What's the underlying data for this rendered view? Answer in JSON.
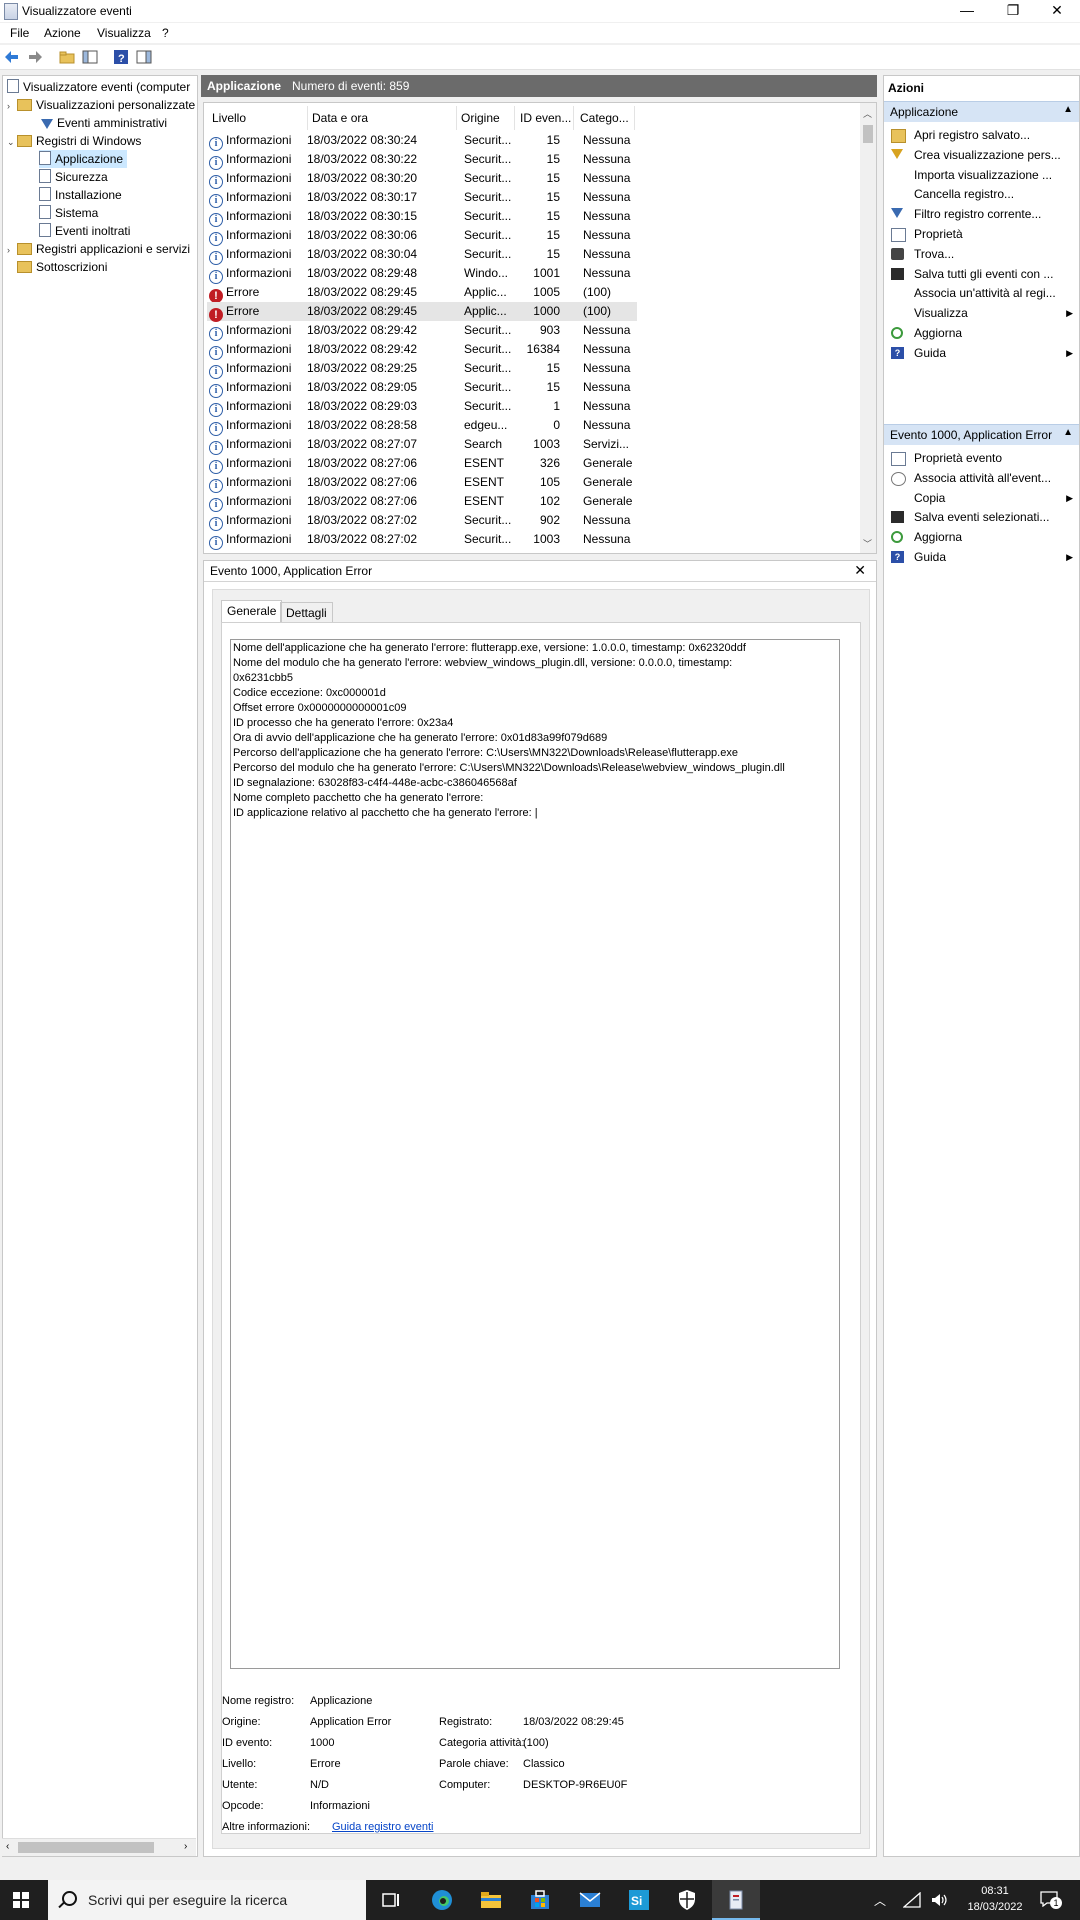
{
  "window": {
    "title": "Visualizzatore eventi",
    "controls": {
      "minimize": "—",
      "restore": "❐",
      "close": "✕"
    }
  },
  "menu": [
    "File",
    "Azione",
    "Visualizza",
    "?"
  ],
  "tree": {
    "root": "Visualizzatore eventi (computer",
    "custom_views": "Visualizzazioni personalizzate",
    "admin_events": "Eventi amministrativi",
    "windows_logs": "Registri di Windows",
    "logs": [
      "Applicazione",
      "Sicurezza",
      "Installazione",
      "Sistema",
      "Eventi inoltrati"
    ],
    "app_services": "Registri applicazioni e servizi",
    "subscriptions": "Sottoscrizioni"
  },
  "list_header": {
    "name": "Applicazione",
    "count_text": "Numero di eventi: 859"
  },
  "columns": [
    "Livello",
    "Data e ora",
    "Origine",
    "ID even...",
    "Catego..."
  ],
  "events": [
    {
      "level": "Informazioni",
      "date": "18/03/2022 08:30:24",
      "source": "Securit...",
      "id": "15",
      "category": "Nessuna",
      "type": "info"
    },
    {
      "level": "Informazioni",
      "date": "18/03/2022 08:30:22",
      "source": "Securit...",
      "id": "15",
      "category": "Nessuna",
      "type": "info"
    },
    {
      "level": "Informazioni",
      "date": "18/03/2022 08:30:20",
      "source": "Securit...",
      "id": "15",
      "category": "Nessuna",
      "type": "info"
    },
    {
      "level": "Informazioni",
      "date": "18/03/2022 08:30:17",
      "source": "Securit...",
      "id": "15",
      "category": "Nessuna",
      "type": "info"
    },
    {
      "level": "Informazioni",
      "date": "18/03/2022 08:30:15",
      "source": "Securit...",
      "id": "15",
      "category": "Nessuna",
      "type": "info"
    },
    {
      "level": "Informazioni",
      "date": "18/03/2022 08:30:06",
      "source": "Securit...",
      "id": "15",
      "category": "Nessuna",
      "type": "info"
    },
    {
      "level": "Informazioni",
      "date": "18/03/2022 08:30:04",
      "source": "Securit...",
      "id": "15",
      "category": "Nessuna",
      "type": "info"
    },
    {
      "level": "Informazioni",
      "date": "18/03/2022 08:29:48",
      "source": "Windo...",
      "id": "1001",
      "category": "Nessuna",
      "type": "info"
    },
    {
      "level": "Errore",
      "date": "18/03/2022 08:29:45",
      "source": "Applic...",
      "id": "1005",
      "category": "(100)",
      "type": "error"
    },
    {
      "level": "Errore",
      "date": "18/03/2022 08:29:45",
      "source": "Applic...",
      "id": "1000",
      "category": "(100)",
      "type": "error"
    },
    {
      "level": "Informazioni",
      "date": "18/03/2022 08:29:42",
      "source": "Securit...",
      "id": "903",
      "category": "Nessuna",
      "type": "info"
    },
    {
      "level": "Informazioni",
      "date": "18/03/2022 08:29:42",
      "source": "Securit...",
      "id": "16384",
      "category": "Nessuna",
      "type": "info"
    },
    {
      "level": "Informazioni",
      "date": "18/03/2022 08:29:25",
      "source": "Securit...",
      "id": "15",
      "category": "Nessuna",
      "type": "info"
    },
    {
      "level": "Informazioni",
      "date": "18/03/2022 08:29:05",
      "source": "Securit...",
      "id": "15",
      "category": "Nessuna",
      "type": "info"
    },
    {
      "level": "Informazioni",
      "date": "18/03/2022 08:29:03",
      "source": "Securit...",
      "id": "1",
      "category": "Nessuna",
      "type": "info"
    },
    {
      "level": "Informazioni",
      "date": "18/03/2022 08:28:58",
      "source": "edgeu...",
      "id": "0",
      "category": "Nessuna",
      "type": "info"
    },
    {
      "level": "Informazioni",
      "date": "18/03/2022 08:27:07",
      "source": "Search",
      "id": "1003",
      "category": "Servizi...",
      "type": "info"
    },
    {
      "level": "Informazioni",
      "date": "18/03/2022 08:27:06",
      "source": "ESENT",
      "id": "326",
      "category": "Generale",
      "type": "info"
    },
    {
      "level": "Informazioni",
      "date": "18/03/2022 08:27:06",
      "source": "ESENT",
      "id": "105",
      "category": "Generale",
      "type": "info"
    },
    {
      "level": "Informazioni",
      "date": "18/03/2022 08:27:06",
      "source": "ESENT",
      "id": "102",
      "category": "Generale",
      "type": "info"
    },
    {
      "level": "Informazioni",
      "date": "18/03/2022 08:27:02",
      "source": "Securit...",
      "id": "902",
      "category": "Nessuna",
      "type": "info"
    },
    {
      "level": "Informazioni",
      "date": "18/03/2022 08:27:02",
      "source": "Securit...",
      "id": "1003",
      "category": "Nessuna",
      "type": "info"
    }
  ],
  "detail": {
    "title": "Evento 1000, Application Error",
    "tabs": [
      "Generale",
      "Dettagli"
    ],
    "description": [
      "Nome dell'applicazione che ha generato l'errore: flutterapp.exe, versione: 1.0.0.0, timestamp: 0x62320ddf",
      "Nome del modulo che ha generato l'errore: webview_windows_plugin.dll, versione: 0.0.0.0, timestamp:",
      "0x6231cbb5",
      "Codice eccezione: 0xc000001d",
      "Offset errore 0x0000000000001c09",
      "ID processo che ha generato l'errore: 0x23a4",
      "Ora di avvio dell'applicazione che ha generato l'errore: 0x01d83a99f079d689",
      "Percorso dell'applicazione che ha generato l'errore: C:\\Users\\MN322\\Downloads\\Release\\flutterapp.exe",
      "Percorso del modulo che ha generato l'errore: C:\\Users\\MN322\\Downloads\\Release\\webview_windows_plugin.dll",
      "ID segnalazione: 63028f83-c4f4-448e-acbc-c386046568af",
      "Nome completo pacchetto che ha generato l'errore:",
      "ID applicazione relativo al pacchetto che ha generato l'errore: |"
    ],
    "props": {
      "log_name_label": "Nome registro:",
      "log_name": "Applicazione",
      "source_label": "Origine:",
      "source": "Application Error",
      "logged_label": "Registrato:",
      "logged": "18/03/2022 08:29:45",
      "event_id_label": "ID evento:",
      "event_id": "1000",
      "task_label": "Categoria attività:",
      "task": "(100)",
      "level_label": "Livello:",
      "level": "Errore",
      "keywords_label": "Parole chiave:",
      "keywords": "Classico",
      "user_label": "Utente:",
      "user": "N/D",
      "computer_label": "Computer:",
      "computer": "DESKTOP-9R6EU0F",
      "opcode_label": "Opcode:",
      "opcode": "Informazioni",
      "more_info_label": "Altre informazioni:",
      "more_info_link": "Guida registro eventi"
    }
  },
  "actions": {
    "title": "Azioni",
    "section1": "Applicazione",
    "items1": [
      {
        "label": "Apri registro salvato...",
        "icon": "folder-icon"
      },
      {
        "label": "Crea visualizzazione pers...",
        "icon": "filter-icon"
      },
      {
        "label": "Importa visualizzazione ...",
        "icon": ""
      },
      {
        "label": "Cancella registro...",
        "icon": ""
      },
      {
        "label": "Filtro registro corrente...",
        "icon": "filter-blue-icon"
      },
      {
        "label": "Proprietà",
        "icon": "properties-icon"
      },
      {
        "label": "Trova...",
        "icon": "binoculars-icon"
      },
      {
        "label": "Salva tutti gli eventi con ...",
        "icon": "save-icon"
      },
      {
        "label": "Associa un'attività al regi...",
        "icon": ""
      },
      {
        "label": "Visualizza",
        "icon": "",
        "sub": true
      },
      {
        "label": "Aggiorna",
        "icon": "refresh-icon"
      },
      {
        "label": "Guida",
        "icon": "help-icon",
        "sub": true
      }
    ],
    "section2": "Evento 1000, Application Error",
    "items2": [
      {
        "label": "Proprietà evento",
        "icon": "properties-icon"
      },
      {
        "label": "Associa attività all'event...",
        "icon": "task-icon"
      },
      {
        "label": "Copia",
        "icon": "copy-icon",
        "sub": true
      },
      {
        "label": "Salva eventi selezionati...",
        "icon": "save-icon"
      },
      {
        "label": "Aggiorna",
        "icon": "refresh-icon"
      },
      {
        "label": "Guida",
        "icon": "help-icon",
        "sub": true
      }
    ]
  },
  "taskbar": {
    "search_placeholder": "Scrivi qui per eseguire la ricerca",
    "time": "08:31",
    "date": "18/03/2022",
    "notification_count": "1"
  }
}
